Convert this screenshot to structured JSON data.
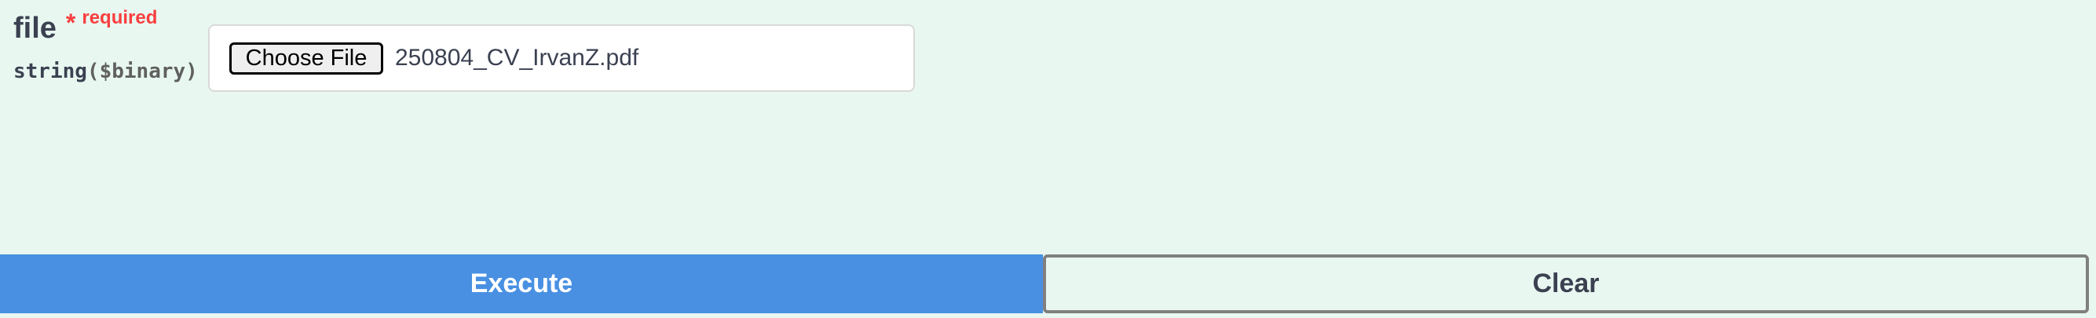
{
  "parameter": {
    "name": "file",
    "required_marker": "*",
    "required_label": "required",
    "type": "string",
    "format": "($binary)"
  },
  "file_input": {
    "button_label": "Choose File",
    "selected_file": "250804_CV_IrvanZ.pdf"
  },
  "actions": {
    "execute_label": "Execute",
    "clear_label": "Clear"
  },
  "colors": {
    "background": "#e8f8f1",
    "execute": "#4990e2",
    "required": "#f93e3e",
    "text": "#3b4151"
  }
}
